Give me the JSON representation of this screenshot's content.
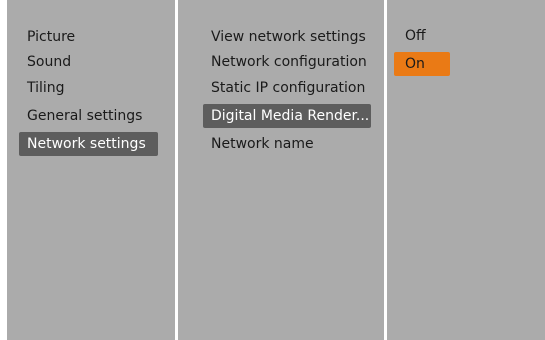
{
  "colors": {
    "panel_background": "#ababab",
    "divider": "#ffffff",
    "selected_background": "#5d5d5d",
    "selected_text": "#ffffff",
    "active_background": "#ea7a15",
    "text": "#1a1a1a"
  },
  "menu": {
    "level1": [
      {
        "label": "Picture"
      },
      {
        "label": "Sound"
      },
      {
        "label": "Tiling"
      },
      {
        "label": "General settings"
      },
      {
        "label": "Network settings",
        "state": "selected"
      }
    ],
    "level2": [
      {
        "label": "View network settings"
      },
      {
        "label": "Network configuration"
      },
      {
        "label": "Static IP configuration"
      },
      {
        "label": "Digital Media Render...",
        "state": "selected"
      },
      {
        "label": "Network name"
      }
    ],
    "level3": [
      {
        "label": "Off"
      },
      {
        "label": "On",
        "state": "active"
      }
    ]
  }
}
